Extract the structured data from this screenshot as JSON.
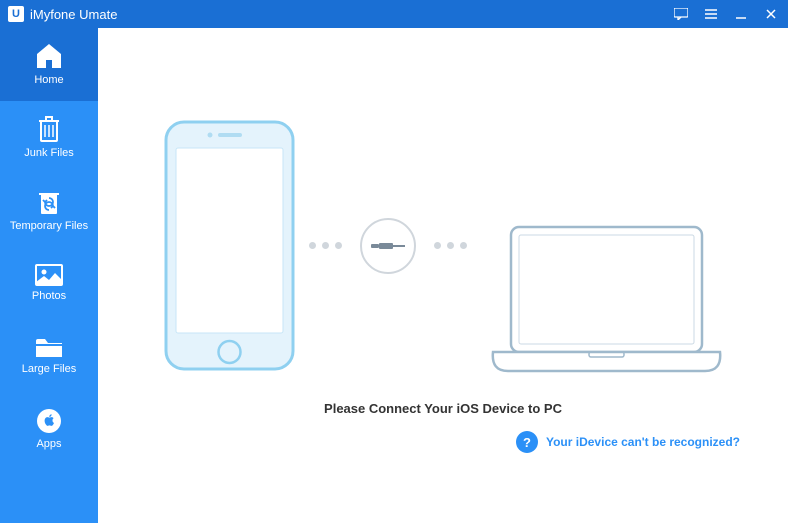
{
  "app": {
    "logo_letter": "U",
    "title": "iMyfone Umate"
  },
  "sidebar": {
    "items": [
      {
        "label": "Home",
        "icon": "home-icon",
        "active": true
      },
      {
        "label": "Junk Files",
        "icon": "trash-icon",
        "active": false
      },
      {
        "label": "Temporary Files",
        "icon": "recycle-icon",
        "active": false
      },
      {
        "label": "Photos",
        "icon": "photos-icon",
        "active": false
      },
      {
        "label": "Large Files",
        "icon": "folder-icon",
        "active": false
      },
      {
        "label": "Apps",
        "icon": "apps-icon",
        "active": false
      }
    ]
  },
  "main": {
    "connect_message": "Please Connect Your iOS Device to PC",
    "help_text": "Your iDevice can't be recognized?",
    "help_symbol": "?"
  },
  "colors": {
    "brand_dark": "#1a6fd4",
    "brand_light": "#2b90f7",
    "phone_outline": "#8fd0f0",
    "phone_fill": "#e4f3fc",
    "laptop_outline": "#9fb9cc"
  }
}
